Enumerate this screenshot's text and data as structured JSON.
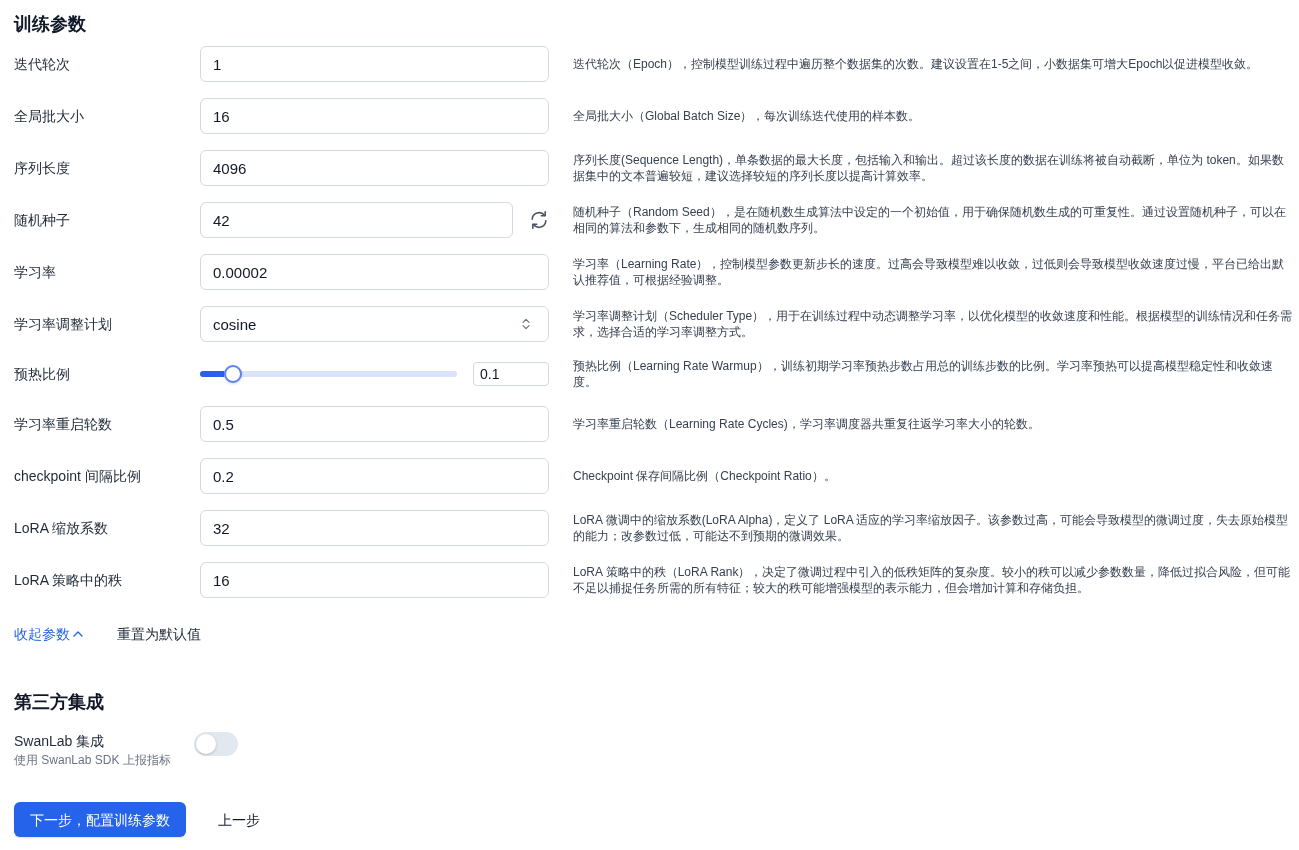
{
  "section_title": "训练参数",
  "params": [
    {
      "kind": "input",
      "label": "迭代轮次",
      "value": "1",
      "description": "迭代轮次（Epoch），控制模型训练过程中遍历整个数据集的次数。建议设置在1-5之间，小数据集可增大Epoch以促进模型收敛。"
    },
    {
      "kind": "input",
      "label": "全局批大小",
      "value": "16",
      "description": "全局批大小（Global Batch Size），每次训练迭代使用的样本数。"
    },
    {
      "kind": "input",
      "label": "序列长度",
      "value": "4096",
      "description": "序列长度(Sequence Length)，单条数据的最大长度，包括输入和输出。超过该长度的数据在训练将被自动截断，单位为 token。如果数据集中的文本普遍较短，建议选择较短的序列长度以提高计算效率。"
    },
    {
      "kind": "input_refresh",
      "label": "随机种子",
      "value": "42",
      "description": "随机种子（Random Seed），是在随机数生成算法中设定的一个初始值，用于确保随机数生成的可重复性。通过设置随机种子，可以在相同的算法和参数下，生成相同的随机数序列。"
    },
    {
      "kind": "input",
      "label": "学习率",
      "value": "0.00002",
      "description": "学习率（Learning Rate），控制模型参数更新步长的速度。过高会导致模型难以收敛，过低则会导致模型收敛速度过慢，平台已给出默认推荐值，可根据经验调整。"
    },
    {
      "kind": "select",
      "label": "学习率调整计划",
      "value": "cosine",
      "description": "学习率调整计划（Scheduler Type），用于在训练过程中动态调整学习率，以优化模型的收敛速度和性能。根据模型的训练情况和任务需求，选择合适的学习率调整方式。"
    },
    {
      "kind": "slider",
      "label": "预热比例",
      "level": 0.1,
      "value": "0.1",
      "description": "预热比例（Learning Rate Warmup），训练初期学习率预热步数占用总的训练步数的比例。学习率预热可以提高模型稳定性和收敛速度。"
    },
    {
      "kind": "input",
      "label": "学习率重启轮数",
      "value": "0.5",
      "description": "学习率重启轮数（Learning Rate Cycles)，学习率调度器共重复往返学习率大小的轮数。"
    },
    {
      "kind": "input",
      "label": "checkpoint 间隔比例",
      "value": "0.2",
      "description": "Checkpoint 保存间隔比例（Checkpoint Ratio）。"
    },
    {
      "kind": "input",
      "label": "LoRA 缩放系数",
      "value": "32",
      "description": "LoRA 微调中的缩放系数(LoRA Alpha)，定义了 LoRA 适应的学习率缩放因子。该参数过高，可能会导致模型的微调过度，失去原始模型的能力；改参数过低，可能达不到预期的微调效果。"
    },
    {
      "kind": "input",
      "label": "LoRA 策略中的秩",
      "value": "16",
      "description": "LoRA 策略中的秩（LoRA Rank），决定了微调过程中引入的低秩矩阵的复杂度。较小的秩可以减少参数数量，降低过拟合风险，但可能不足以捕捉任务所需的所有特征；较大的秩可能增强模型的表示能力，但会增加计算和存储负担。"
    }
  ],
  "param_links": [
    {
      "kind": "collapse",
      "label": "收起参数",
      "expanded": true
    },
    {
      "kind": "plain",
      "label": "重置为默认值"
    }
  ],
  "integrations": {
    "title": "第三方集成",
    "items": [
      {
        "label": "SwanLab 集成",
        "hint": "使用 SwanLab SDK 上报指标",
        "on": false
      }
    ]
  },
  "buttons": [
    {
      "kind": "primary",
      "label": "下一步，配置训练参数"
    },
    {
      "kind": "secondary",
      "label": "上一步"
    }
  ]
}
